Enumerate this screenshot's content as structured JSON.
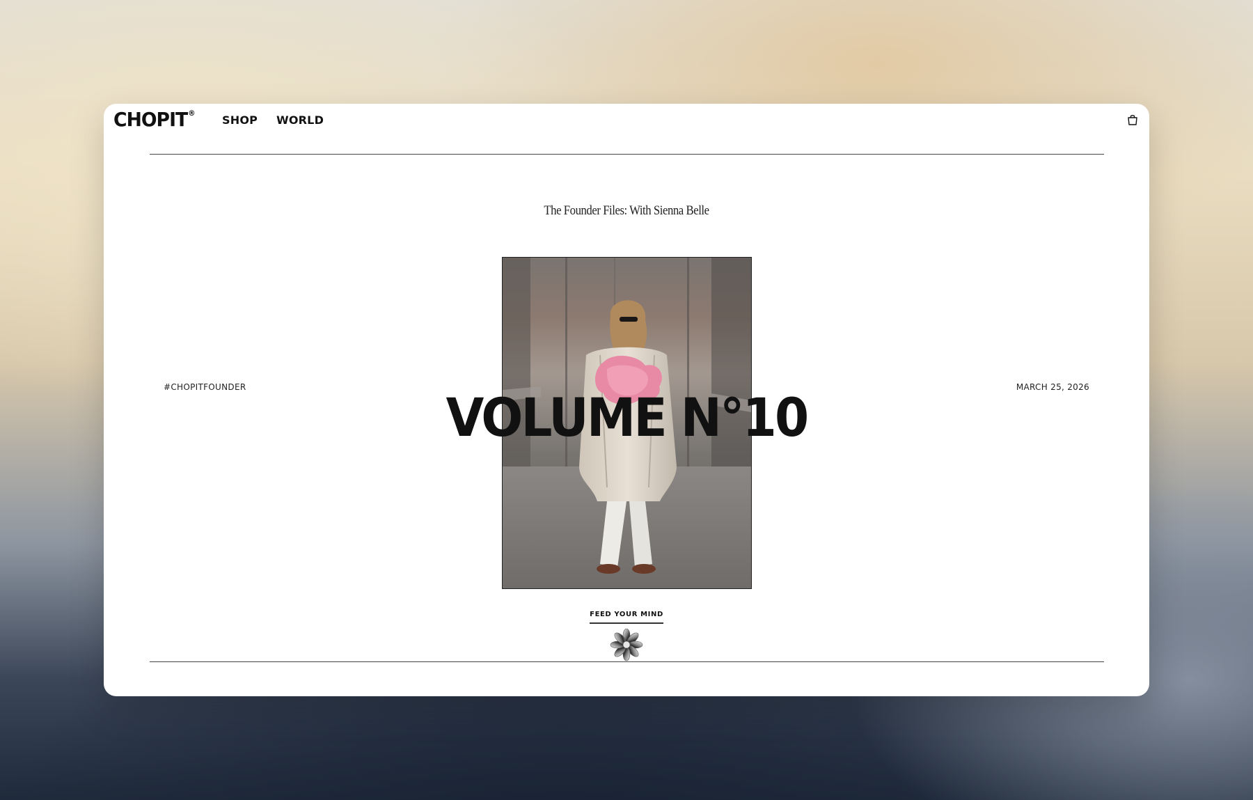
{
  "header": {
    "logo": "CHOPIT",
    "logo_mark": "®",
    "nav": [
      {
        "label": "SHOP"
      },
      {
        "label": "WORLD"
      }
    ],
    "cart_icon": "shopping-bag-icon"
  },
  "article": {
    "title": "The Founder Files: With Sienna Belle",
    "tag": "#CHOPITFOUNDER",
    "date": "MARCH 25, 2026",
    "headline": "VOLUME N°10",
    "cta_label": "FEED YOUR MIND",
    "decoration_icon": "chrome-flower-icon"
  },
  "colors": {
    "text": "#111111",
    "rule": "#444444",
    "window_bg": "#ffffff"
  }
}
